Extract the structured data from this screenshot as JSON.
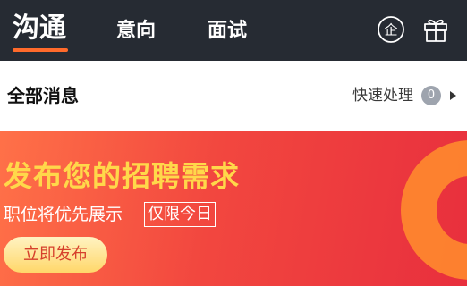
{
  "nav": {
    "tabs": [
      {
        "label": "沟通",
        "active": true
      },
      {
        "label": "意向",
        "active": false
      },
      {
        "label": "面试",
        "active": false
      }
    ],
    "icons": {
      "company": "enterprise-icon",
      "gift": "gift-icon"
    },
    "company_icon_char": "企"
  },
  "messages": {
    "title": "全部消息",
    "quick_label": "快速处理",
    "quick_count": "0"
  },
  "banner": {
    "title": "发布您的招聘需求",
    "subtitle": "职位将优先展示",
    "tag": "仅限今日",
    "button_label": "立即发布"
  },
  "colors": {
    "topbar": "#262b33",
    "active_underline": "#ff6a2b",
    "banner_title": "#ffd84a",
    "banner_bg": "#f2473f"
  }
}
